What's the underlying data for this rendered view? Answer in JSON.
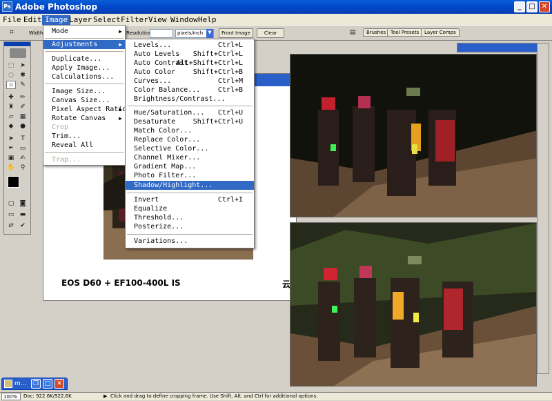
{
  "app": {
    "title": "Adobe Photoshop",
    "icon": "photoshop-icon"
  },
  "window_buttons": {
    "minimize": "_",
    "maximize": "□",
    "close": "✕"
  },
  "menubar": [
    "File",
    "Edit",
    "Image",
    "Layer",
    "Select",
    "Filter",
    "View",
    "Window",
    "Help"
  ],
  "options": {
    "width_label": "Width",
    "resolution_label": "Resolution:",
    "resolution_value": "",
    "unit_select": "pixels/inch",
    "front_image": "Front Image",
    "clear": "Clear"
  },
  "palette_tabs": [
    "Brushes",
    "Tool Presets",
    "Layer Comps"
  ],
  "image_menu": [
    {
      "label": "Mode",
      "submenu": true
    },
    {
      "separator": true
    },
    {
      "label": "Adjustments",
      "submenu": true,
      "highlight": true
    },
    {
      "separator": true
    },
    {
      "label": "Duplicate..."
    },
    {
      "label": "Apply Image..."
    },
    {
      "label": "Calculations..."
    },
    {
      "separator": true
    },
    {
      "label": "Image Size..."
    },
    {
      "label": "Canvas Size..."
    },
    {
      "label": "Pixel Aspect Ratio",
      "submenu": true
    },
    {
      "label": "Rotate Canvas",
      "submenu": true
    },
    {
      "label": "Crop",
      "disabled": true
    },
    {
      "label": "Trim..."
    },
    {
      "label": "Reveal All"
    },
    {
      "separator": true
    },
    {
      "label": "Trap...",
      "disabled": true
    }
  ],
  "adjustments_menu": [
    {
      "label": "Levels...",
      "shortcut": "Ctrl+L"
    },
    {
      "label": "Auto Levels",
      "shortcut": "Shift+Ctrl+L"
    },
    {
      "label": "Auto Contrast",
      "shortcut": "Alt+Shift+Ctrl+L"
    },
    {
      "label": "Auto Color",
      "shortcut": "Shift+Ctrl+B"
    },
    {
      "label": "Curves...",
      "shortcut": "Ctrl+M"
    },
    {
      "label": "Color Balance...",
      "shortcut": "Ctrl+B"
    },
    {
      "label": "Brightness/Contrast...",
      "shortcut": ""
    },
    {
      "separator": true
    },
    {
      "label": "Hue/Saturation...",
      "shortcut": "Ctrl+U"
    },
    {
      "label": "Desaturate",
      "shortcut": "Shift+Ctrl+U"
    },
    {
      "label": "Match Color...",
      "shortcut": ""
    },
    {
      "label": "Replace Color...",
      "shortcut": ""
    },
    {
      "label": "Selective Color...",
      "shortcut": ""
    },
    {
      "label": "Channel Mixer...",
      "shortcut": ""
    },
    {
      "label": "Gradient Map...",
      "shortcut": ""
    },
    {
      "label": "Photo Filter...",
      "shortcut": ""
    },
    {
      "label": "Shadow/Highlight...",
      "shortcut": "",
      "highlight": true
    },
    {
      "separator": true
    },
    {
      "label": "Invert",
      "shortcut": "Ctrl+I"
    },
    {
      "label": "Equalize",
      "shortcut": ""
    },
    {
      "label": "Threshold...",
      "shortcut": ""
    },
    {
      "label": "Posterize...",
      "shortcut": ""
    },
    {
      "separator": true
    },
    {
      "label": "Variations...",
      "shortcut": ""
    }
  ],
  "document": {
    "caption": "EOS D60 + EF100-400L IS",
    "corner_char": "云"
  },
  "minimized_window": {
    "label": "m..."
  },
  "status": {
    "zoom": "100%",
    "doc": "Doc: 922.6K/922.6K",
    "hint": "Click and drag to define cropping frame. Use Shift, Alt, and Ctrl for additional options."
  },
  "colors": {
    "title_blue": "#0046c8",
    "menu_highlight": "#316ac5",
    "ui_gray": "#d4d0c8"
  }
}
